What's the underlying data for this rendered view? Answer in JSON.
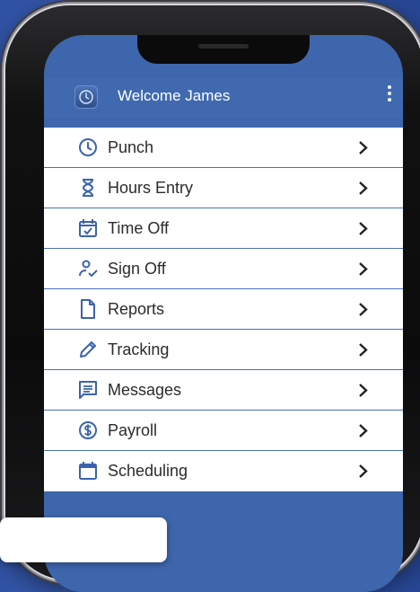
{
  "app": {
    "title": "Welcome James",
    "accent_color": "#4069b0",
    "icon": "clock-icon"
  },
  "menu": {
    "items": [
      {
        "label": "Punch",
        "icon": "clock-icon"
      },
      {
        "label": "Hours Entry",
        "icon": "hourglass-icon"
      },
      {
        "label": "Time Off",
        "icon": "calendar-check-icon"
      },
      {
        "label": "Sign Off",
        "icon": "user-check-icon"
      },
      {
        "label": "Reports",
        "icon": "document-icon"
      },
      {
        "label": "Tracking",
        "icon": "pencil-icon"
      },
      {
        "label": "Messages",
        "icon": "message-icon"
      },
      {
        "label": "Payroll",
        "icon": "dollar-icon"
      },
      {
        "label": "Scheduling",
        "icon": "calendar-icon"
      }
    ],
    "chevron_icon": "chevron-right-icon"
  }
}
